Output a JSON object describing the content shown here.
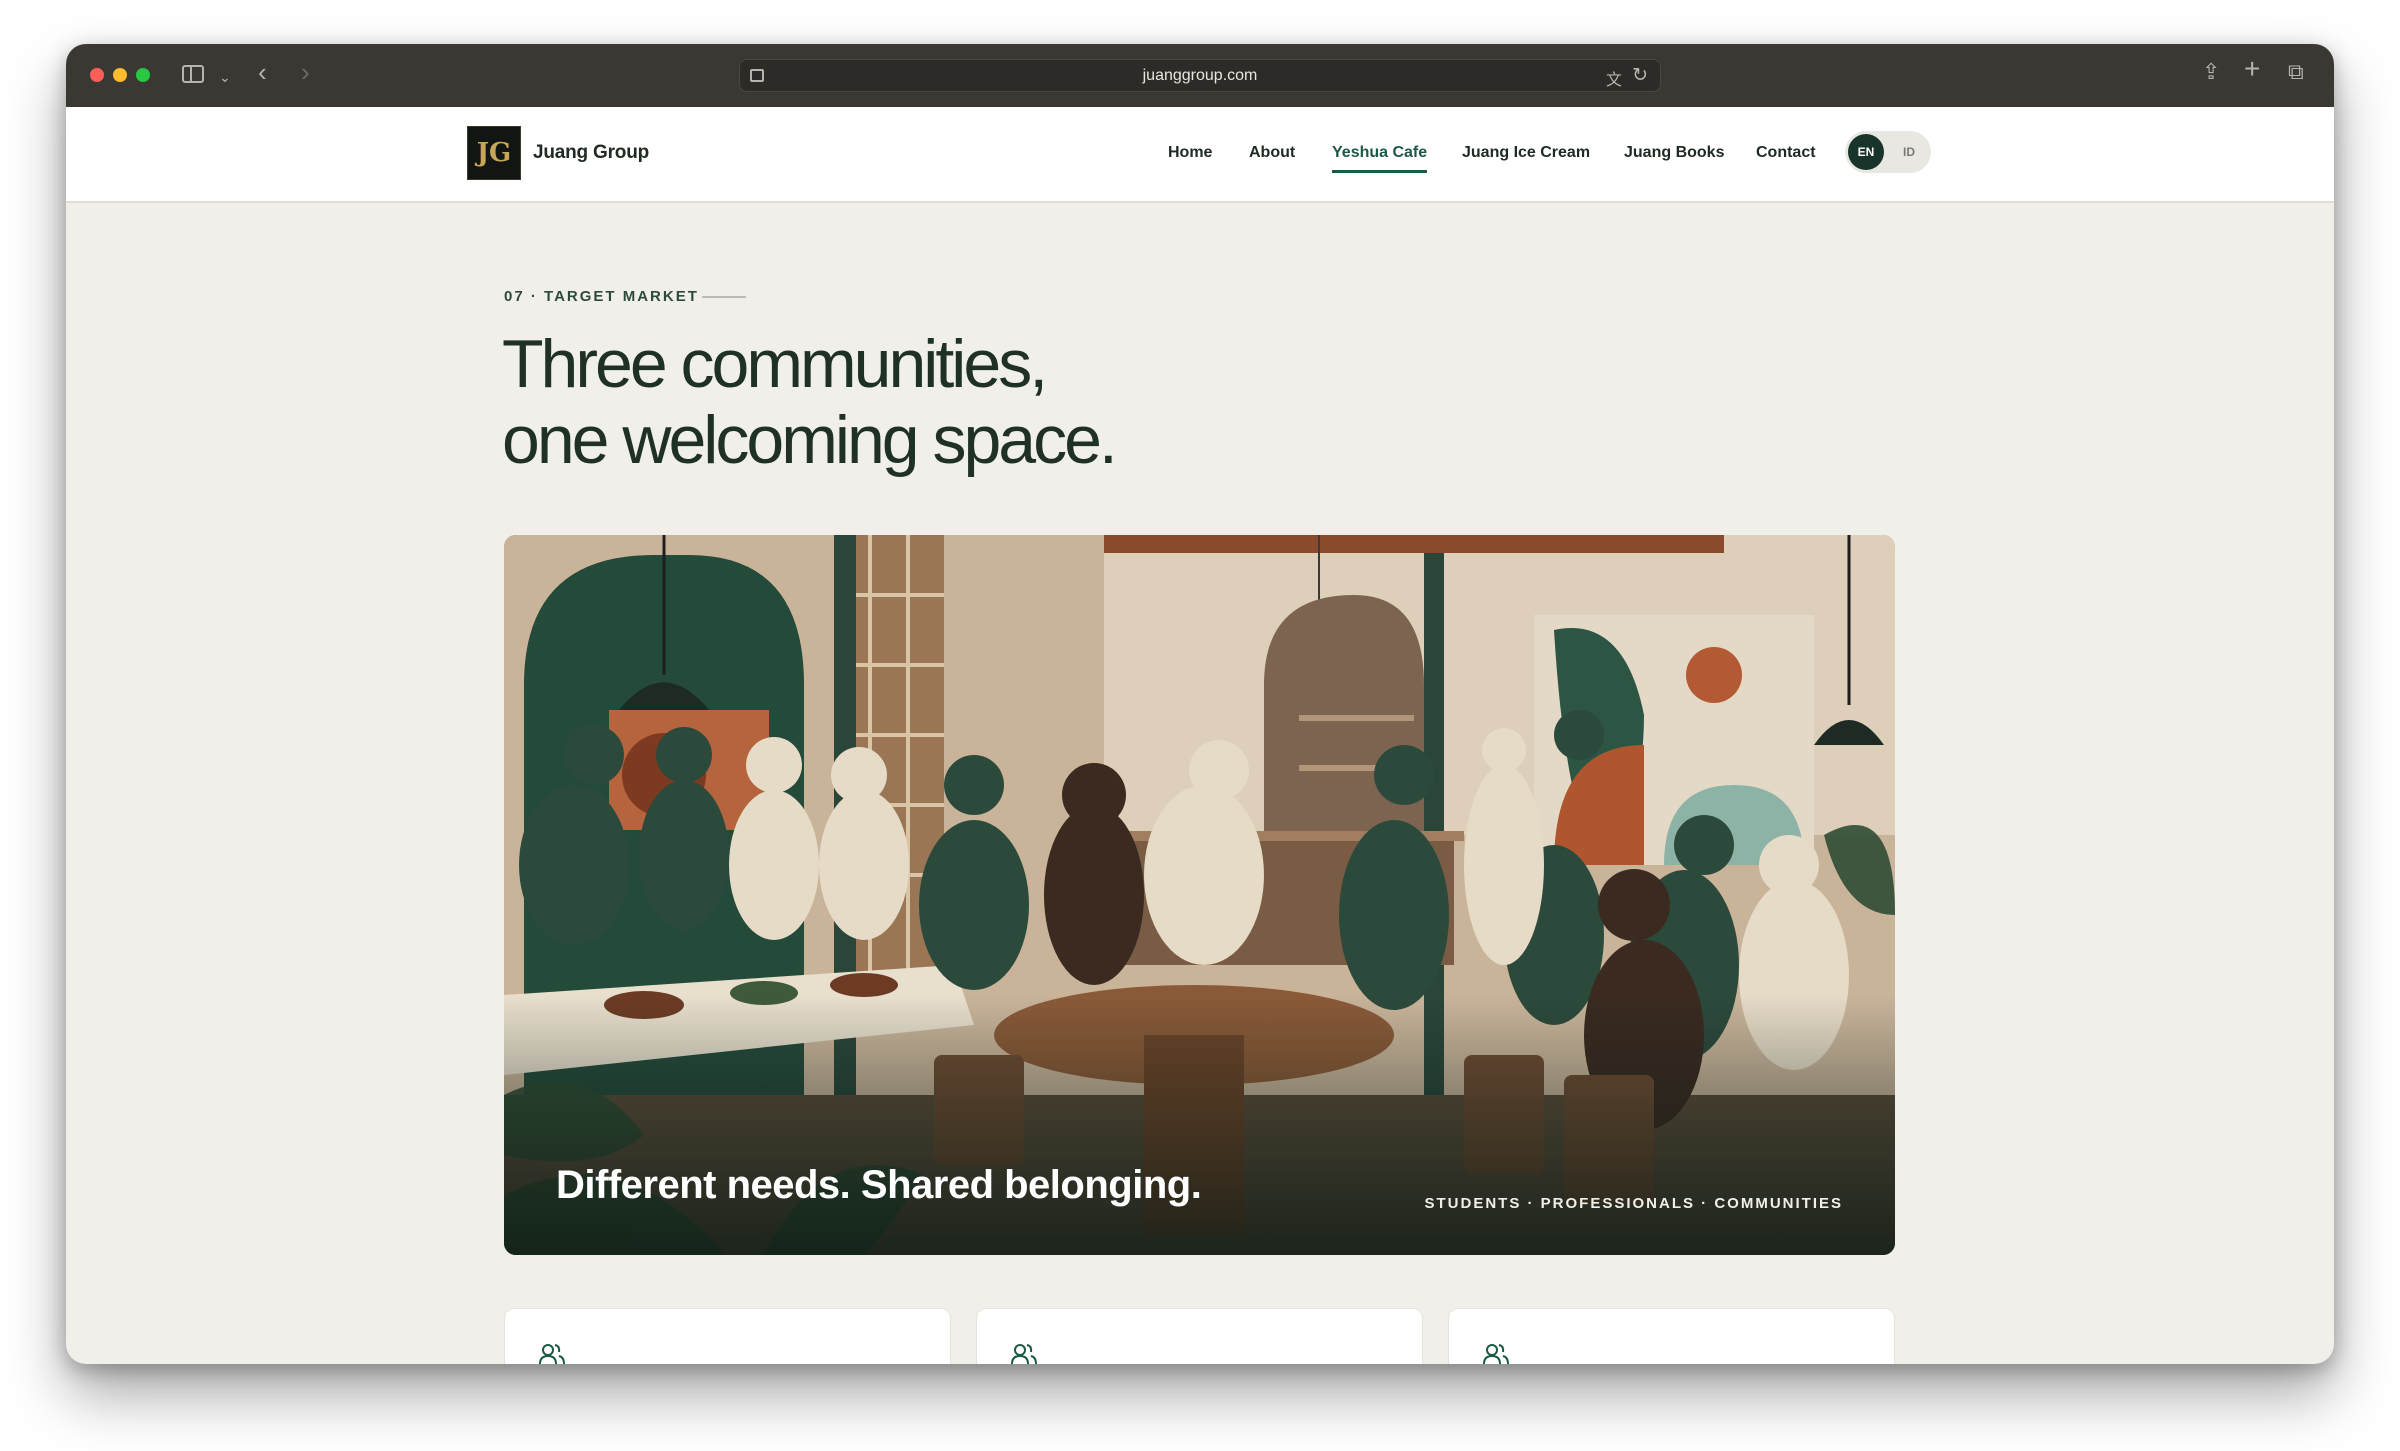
{
  "browser": {
    "url": "juanggroup.com"
  },
  "header": {
    "brand": "Juang Group",
    "nav": [
      {
        "label": "Home"
      },
      {
        "label": "About"
      },
      {
        "label": "Yeshua Cafe"
      },
      {
        "label": "Juang Ice Cream"
      },
      {
        "label": "Juang Books"
      },
      {
        "label": "Contact"
      }
    ],
    "active_nav": "Yeshua Cafe",
    "language": {
      "options": [
        "EN",
        "ID"
      ],
      "selected": "EN"
    }
  },
  "section": {
    "eyebrow": "07 · TARGET MARKET",
    "headline_line1": "Three communities,",
    "headline_line2": "one welcoming space."
  },
  "hero": {
    "caption": "Different needs. Shared belonging.",
    "tags": "STUDENTS · PROFESSIONALS · COMMUNITIES"
  },
  "cards": [
    {
      "icon": "people-icon"
    },
    {
      "icon": "people-icon"
    },
    {
      "icon": "people-icon"
    }
  ],
  "colors": {
    "accent": "#1d5a43",
    "page_background": "#f1efea",
    "headline": "#1f3127"
  }
}
